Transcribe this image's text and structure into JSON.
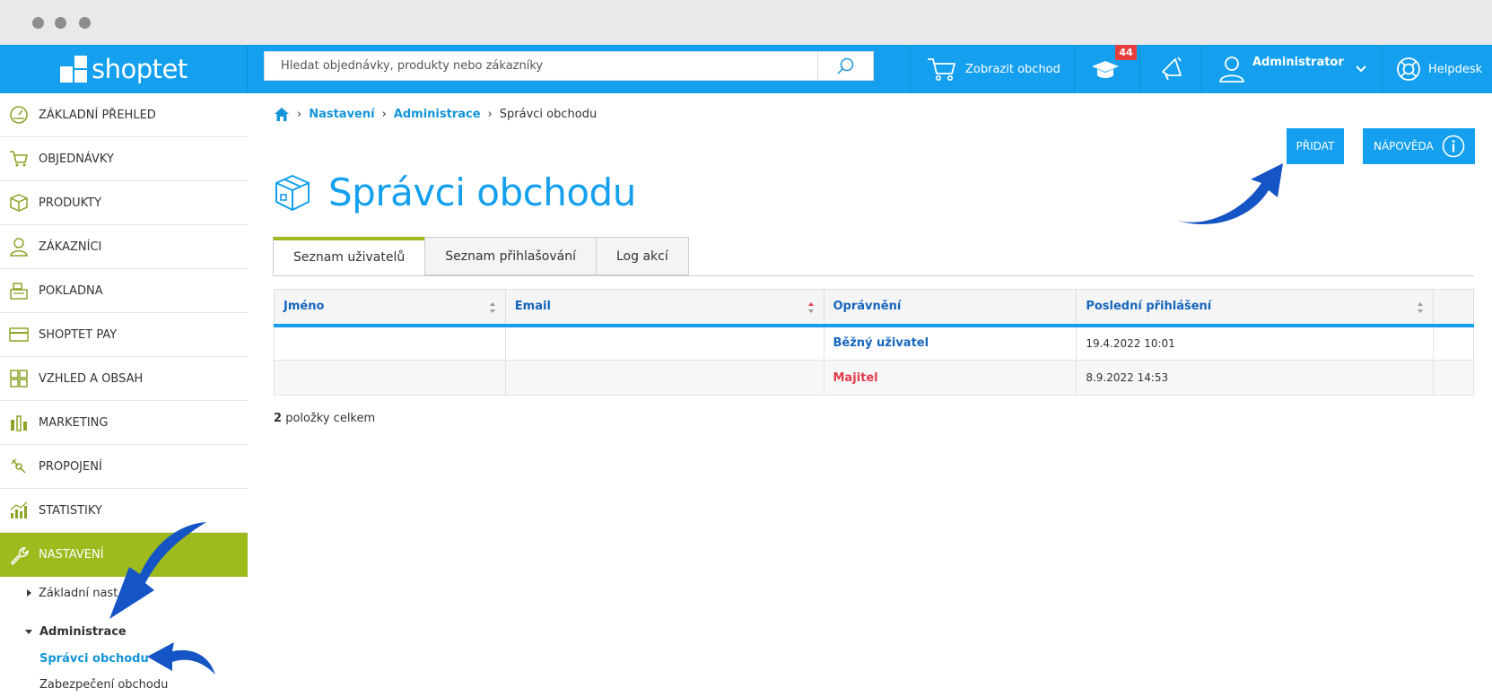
{
  "app": {
    "logo_text": "shoptet"
  },
  "topbar": {
    "search_placeholder": "Hledat objednávky, produkty nebo zákazníky",
    "show_store_label": "Zobrazit obchod",
    "academy_badge": "44",
    "user_label": "Administrator",
    "helpdesk_label": "Helpdesk"
  },
  "sidebar": {
    "items": [
      {
        "label": "ZÁKLADNÍ PŘEHLED",
        "icon": "dashboard-icon"
      },
      {
        "label": "OBJEDNÁVKY",
        "icon": "cart-icon"
      },
      {
        "label": "PRODUKTY",
        "icon": "box-icon"
      },
      {
        "label": "ZÁKAZNÍCI",
        "icon": "person-icon"
      },
      {
        "label": "POKLADNA",
        "icon": "cash-register-icon"
      },
      {
        "label": "SHOPTET PAY",
        "icon": "card-icon"
      },
      {
        "label": "VZHLED A OBSAH",
        "icon": "layout-icon"
      },
      {
        "label": "MARKETING",
        "icon": "marketing-icon"
      },
      {
        "label": "PROPOJENÍ",
        "icon": "plug-icon"
      },
      {
        "label": "STATISTIKY",
        "icon": "stats-icon"
      },
      {
        "label": "NASTAVENÍ",
        "icon": "wrench-icon"
      }
    ],
    "sub": {
      "basic_settings": "Základní nast",
      "administration": "Administrace",
      "store_admins": "Správci obchodu",
      "store_security": "Zabezpečení obchodu"
    }
  },
  "breadcrumb": {
    "level1": "Nastavení",
    "level2": "Administrace",
    "current": "Správci obchodu"
  },
  "actions": {
    "add_label": "PŘIDAT",
    "help_label": "NÁPOVĚDA"
  },
  "page_title": "Správci obchodu",
  "tabs": [
    "Seznam uživatelů",
    "Seznam přihlašování",
    "Log akcí"
  ],
  "table": {
    "headers": [
      "Jméno",
      "Email",
      "Oprávnění",
      "Poslední přihlášení"
    ],
    "rows": [
      {
        "name": "",
        "email": "",
        "role": "Běžný uživatel",
        "last_login": "19.4.2022 10:01"
      },
      {
        "name": "",
        "email": "",
        "role": "Majitel",
        "last_login": "8.9.2022 14:53"
      }
    ]
  },
  "summary": {
    "count": "2",
    "text": "položky celkem"
  },
  "colors": {
    "primary": "#14a0ee",
    "active_nav": "#9dba1f",
    "link": "#1566bd",
    "owner": "#e43b4e",
    "badge": "#e83d3d"
  }
}
